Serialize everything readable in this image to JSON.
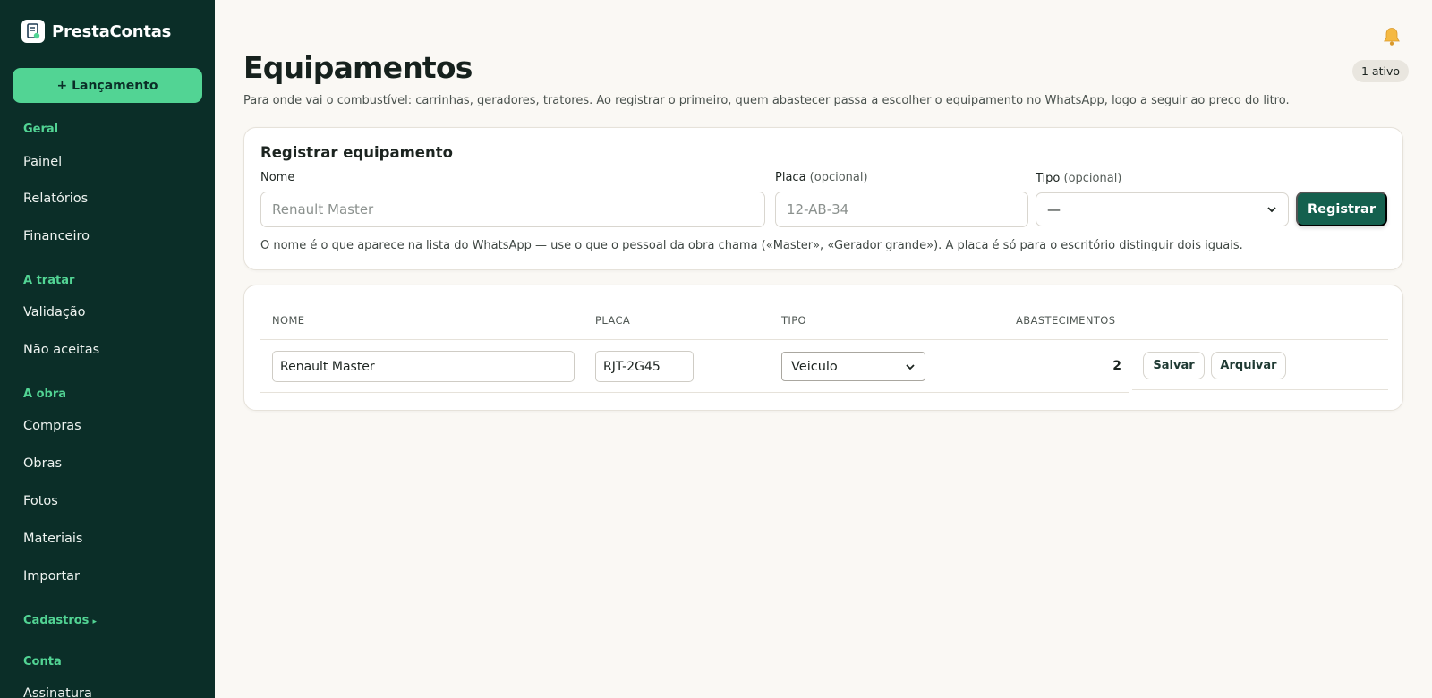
{
  "brand": {
    "name": "PrestaContas",
    "logo_icon": "receipt-logo-icon"
  },
  "sidebar": {
    "new_button": "+ Lançamento",
    "sections": [
      {
        "title": "Geral",
        "items": [
          "Painel",
          "Relatórios",
          "Financeiro"
        ]
      },
      {
        "title": "A tratar",
        "items": [
          "Validação",
          "Não aceitas"
        ]
      },
      {
        "title": "A obra",
        "items": [
          "Compras",
          "Obras",
          "Fotos",
          "Materiais",
          "Importar"
        ]
      },
      {
        "title": "Cadastros",
        "collapsed": true,
        "items": []
      },
      {
        "title": "Conta",
        "items": [
          "Assinatura"
        ]
      }
    ]
  },
  "header": {
    "notification_icon": "bell-icon",
    "title": "Equipamentos",
    "badge": "1 ativo",
    "subtitle": "Para onde vai o combustível: carrinhas, geradores, tratores. Ao registrar o primeiro, quem abastecer passa a escolher o equipamento no WhatsApp, logo a seguir ao preço do litro."
  },
  "register": {
    "title": "Registrar equipamento",
    "name_label": "Nome",
    "name_placeholder": "Renault Master",
    "plate_label": "Placa",
    "plate_optional": "(opcional)",
    "plate_placeholder": "12-AB-34",
    "type_label": "Tipo",
    "type_optional": "(opcional)",
    "type_value": "—",
    "submit": "Registrar",
    "help": "O nome é o que aparece na lista do WhatsApp — use o que o pessoal da obra chama («Master», «Gerador grande»). A placa é só para o escritório distinguir dois iguais."
  },
  "table": {
    "headers": [
      "NOME",
      "PLACA",
      "TIPO",
      "ABASTECIMENTOS"
    ],
    "rows": [
      {
        "name": "Renault Master",
        "plate": "RJT-2G45",
        "type": "Veiculo",
        "refuels": "2",
        "save": "Salvar",
        "archive": "Arquivar"
      }
    ]
  },
  "colors": {
    "sidebar_bg": "#0b2e28",
    "accent": "#52d494",
    "primary": "#14604e",
    "page_bg": "#faf8f4"
  }
}
